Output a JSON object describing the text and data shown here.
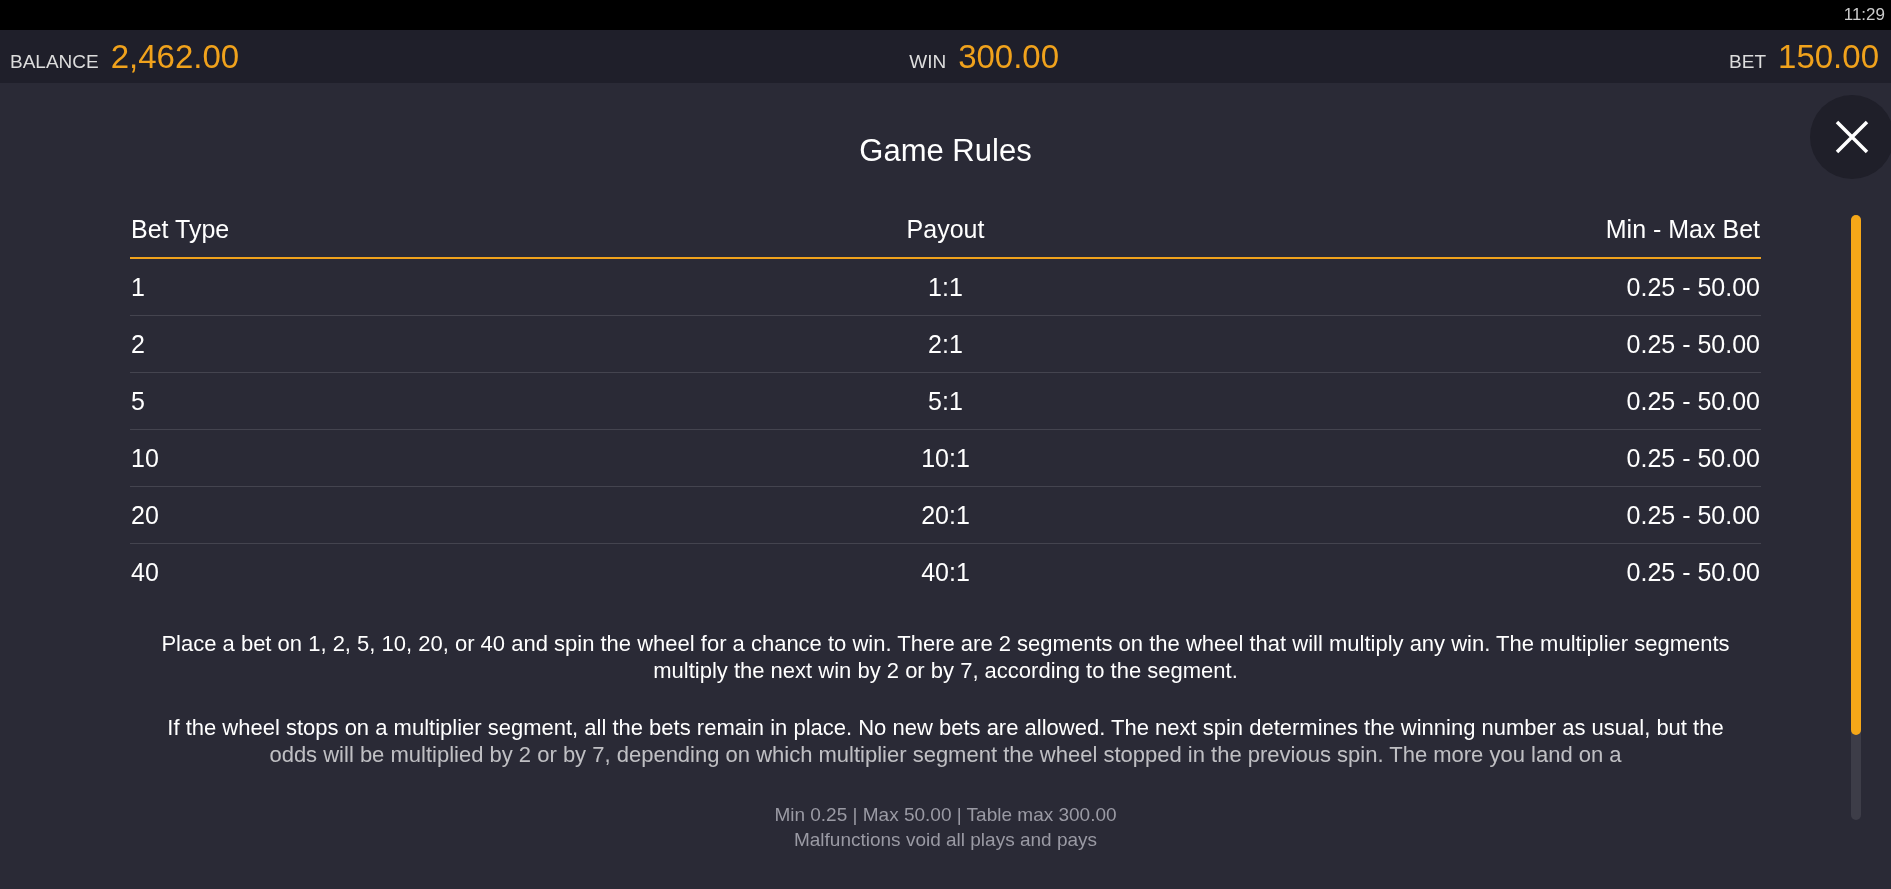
{
  "status_bar": {
    "time": "11:29"
  },
  "header": {
    "balance": {
      "label": "BALANCE",
      "value": "2,462.00"
    },
    "win": {
      "label": "WIN",
      "value": "300.00"
    },
    "bet": {
      "label": "BET",
      "value": "150.00"
    }
  },
  "rules": {
    "title": "Game Rules",
    "table": {
      "columns": [
        "Bet Type",
        "Payout",
        "Min - Max Bet"
      ],
      "rows": [
        [
          "1",
          "1:1",
          "0.25 - 50.00"
        ],
        [
          "2",
          "2:1",
          "0.25 - 50.00"
        ],
        [
          "5",
          "5:1",
          "0.25 - 50.00"
        ],
        [
          "10",
          "10:1",
          "0.25 - 50.00"
        ],
        [
          "20",
          "20:1",
          "0.25 - 50.00"
        ],
        [
          "40",
          "40:1",
          "0.25 - 50.00"
        ]
      ]
    },
    "paragraphs": [
      "Place a bet on 1, 2, 5, 10, 20, or 40 and spin the wheel for a chance to win. There are 2 segments on the wheel that will multiply any win. The multiplier segments multiply the next win by 2 or by 7, according to the segment.",
      "If the wheel stops on a multiplier segment, all the bets remain in place. No new bets are allowed. The next spin determines the winning number as usual, but the odds will be multiplied by 2 or by 7, depending on which multiplier segment the wheel stopped in the previous spin. The more you land on a"
    ]
  },
  "footer": [
    "Min 0.25 | Max 50.00 | Table max 300.00",
    "Malfunctions void all plays and pays"
  ]
}
